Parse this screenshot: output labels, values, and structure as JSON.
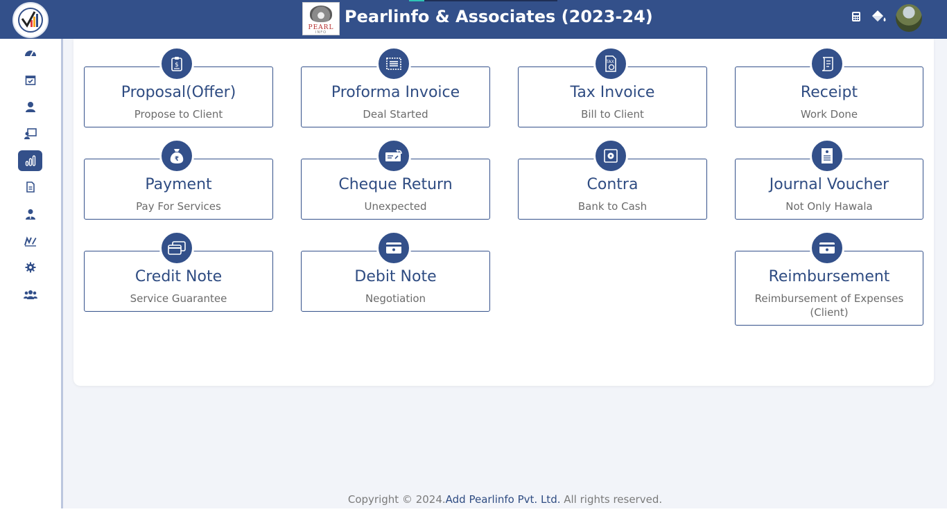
{
  "header": {
    "app_title": "Pearlinfo & Associates (2023-24)",
    "brand_logo_text": "PEARL",
    "brand_logo_subtext": "INFO",
    "icons": [
      "calculator-icon",
      "paint-bucket-icon",
      "user-avatar"
    ]
  },
  "sidebar": {
    "items": [
      {
        "icon": "dashboard-gauge-icon",
        "active": false
      },
      {
        "icon": "calendar-check-icon",
        "active": false
      },
      {
        "icon": "user-icon",
        "active": false
      },
      {
        "icon": "teacher-board-icon",
        "active": false
      },
      {
        "icon": "bar-chart-icon",
        "active": true
      },
      {
        "icon": "document-icon",
        "active": false
      },
      {
        "icon": "user-tie-icon",
        "active": false
      },
      {
        "icon": "signature-icon",
        "active": false
      },
      {
        "icon": "gear-icon",
        "active": false
      },
      {
        "icon": "users-group-icon",
        "active": false
      }
    ]
  },
  "cards": [
    {
      "title": "Proposal(Offer)",
      "subtitle": "Propose to Client",
      "icon": "clipboard-dollar-icon"
    },
    {
      "title": "Proforma Invoice",
      "subtitle": "Deal Started",
      "icon": "stamp-invoice-icon"
    },
    {
      "title": "Tax Invoice",
      "subtitle": "Bill to Client",
      "icon": "tax-document-icon"
    },
    {
      "title": "Receipt",
      "subtitle": "Work Done",
      "icon": "receipt-icon"
    },
    {
      "title": "Payment",
      "subtitle": "Pay For Services",
      "icon": "money-bag-rupee-icon"
    },
    {
      "title": "Cheque Return",
      "subtitle": "Unexpected",
      "icon": "cheque-return-icon"
    },
    {
      "title": "Contra",
      "subtitle": "Bank to Cash",
      "icon": "safe-icon"
    },
    {
      "title": "Journal Voucher",
      "subtitle": "Not Only Hawala",
      "icon": "voucher-document-icon"
    },
    {
      "title": "Credit Note",
      "subtitle": "Service Guarantee",
      "icon": "credit-cards-icon"
    },
    {
      "title": "Debit Note",
      "subtitle": "Negotiation",
      "icon": "debit-card-icon"
    },
    {
      "title": "Reimbursement",
      "subtitle": "Reimbursement of Expenses (Client)",
      "icon": "wallet-card-icon"
    }
  ],
  "footer": {
    "copyright": "Copyright © 2024.",
    "company_link": "Add Pearlinfo Pvt. Ltd.",
    "rights": " All rights reserved."
  },
  "colors": {
    "primary": "#33508a",
    "content_background": "#f2f4f9",
    "subtitle_text": "#6b6b6b"
  }
}
